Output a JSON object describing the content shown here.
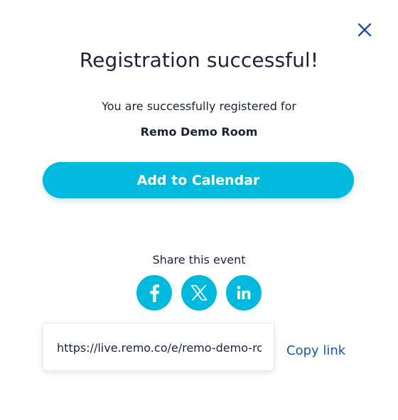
{
  "dialog": {
    "title": "Registration successful!",
    "subtitle": "You are successfully registered for",
    "event_name": "Remo Demo Room",
    "add_to_calendar_label": "Add to Calendar",
    "share_label": "Share this event",
    "social_icons": [
      "facebook-icon",
      "x-twitter-icon",
      "linkedin-icon"
    ],
    "event_link": "https://live.remo.co/e/remo-demo-room",
    "copy_link_label": "Copy link",
    "close_icon": "close-icon"
  },
  "colors": {
    "accent": "#00b9dc",
    "link": "#1b56a5",
    "text": "#1b2437",
    "close": "#1b4fa0"
  }
}
